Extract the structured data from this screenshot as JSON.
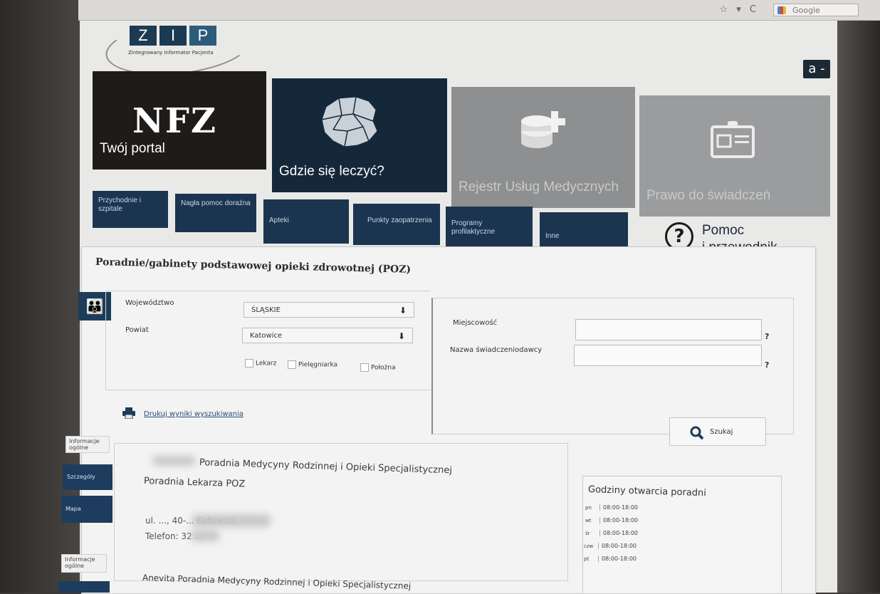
{
  "browser": {
    "search_engine": "Google",
    "icons": "☆ ▾ C"
  },
  "logo": {
    "letters": [
      "Z",
      "I",
      "P"
    ],
    "subtitle": "Zintegrowany Informator Pacjenta"
  },
  "accessibility_label": "a -",
  "tiles": {
    "nfz": {
      "logo": "NFZ",
      "label": "Twój portal"
    },
    "gdzie": {
      "label": "Gdzie się leczyć?"
    },
    "rejestr": {
      "label": "Rejestr Usług Medycznych"
    },
    "prawo": {
      "label": "Prawo do świadczeń"
    }
  },
  "subnav": [
    "Przychodnie i szpitale",
    "Nagła pomoc doraźna",
    "Apteki",
    "Punkty zaopatrzenia",
    "Programy profilaktyczne",
    "Inne"
  ],
  "help": {
    "line1": "Pomoc",
    "line2": "i przewodnik"
  },
  "form": {
    "title": "Poradnie/gabinety podstawowej opieki zdrowotnej (POZ)",
    "wojewodztwo_label": "Województwo",
    "wojewodztwo_value": "ŚLĄSKIE",
    "powiat_label": "Powiat",
    "powiat_value": "Katowice",
    "checkboxes": [
      "Lekarz",
      "Pielęgniarka",
      "Położna"
    ],
    "miejscowosc_label": "Miejscowość",
    "nazwa_label": "Nazwa świadczeniodawcy",
    "help_mark": "?",
    "print_link": "Drukuj wyniki wyszukiwania",
    "search_button": "Szukaj"
  },
  "result_tabs": {
    "informacje": "Informacje ogólne",
    "szczegoly": "Szczegóły",
    "mapa": "Mapa"
  },
  "results": [
    {
      "name_line1": "Poradnia Medycyny Rodzinnej i Opieki Specjalistycznej",
      "name_line2": "Poradnia Lekarza POZ",
      "address": "ul. ..., 40-... Katowice",
      "phone": "Telefon: 32 ..."
    },
    {
      "name_line1": "Anevita Poradnia Medycyny Rodzinnej i Opieki Specjalistycznej"
    }
  ],
  "hours": {
    "title": "Godziny otwarcia poradni",
    "rows": [
      {
        "day": "pn",
        "time": "08:00-18:00"
      },
      {
        "day": "wt",
        "time": "08:00-18:00"
      },
      {
        "day": "śr",
        "time": "08:00-18:00"
      },
      {
        "day": "czw",
        "time": "08:00-18:00"
      },
      {
        "day": "pt",
        "time": "08:00-18:00"
      }
    ]
  }
}
